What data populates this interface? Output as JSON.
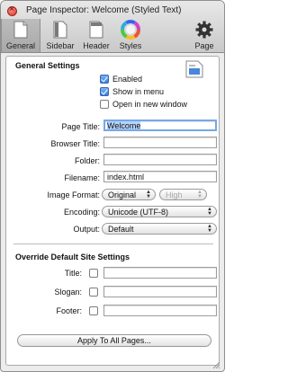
{
  "window": {
    "title": "Page Inspector: Welcome (Styled Text)"
  },
  "toolbar": {
    "tabs": [
      {
        "label": "General",
        "icon": "general-page-icon"
      },
      {
        "label": "Sidebar",
        "icon": "sidebar-icon"
      },
      {
        "label": "Header",
        "icon": "header-icon"
      },
      {
        "label": "Styles",
        "icon": "color-wheel-icon"
      }
    ],
    "page_button": {
      "label": "Page",
      "icon": "gear-icon"
    }
  },
  "general": {
    "section_title": "General Settings",
    "enabled": {
      "label": "Enabled",
      "checked": true
    },
    "show_in_menu": {
      "label": "Show in menu",
      "checked": true
    },
    "open_new_window": {
      "label": "Open in new window",
      "checked": false
    },
    "page_title": {
      "label": "Page Title:",
      "value": "Welcome"
    },
    "browser_title": {
      "label": "Browser Title:",
      "value": ""
    },
    "folder": {
      "label": "Folder:",
      "value": ""
    },
    "filename": {
      "label": "Filename:",
      "value": "index.html"
    },
    "image_format": {
      "label": "Image Format:",
      "value": "Original",
      "quality": "High"
    },
    "encoding": {
      "label": "Encoding:",
      "value": "Unicode (UTF-8)"
    },
    "output": {
      "label": "Output:",
      "value": "Default"
    }
  },
  "override": {
    "section_title": "Override Default Site Settings",
    "title": {
      "label": "Title:",
      "value": ""
    },
    "slogan": {
      "label": "Slogan:",
      "value": ""
    },
    "footer": {
      "label": "Footer:",
      "value": ""
    }
  },
  "apply_button": {
    "label": "Apply To All Pages..."
  },
  "colors": {
    "accent": "#3b7fe1",
    "focus_ring": "#76a7e8"
  }
}
